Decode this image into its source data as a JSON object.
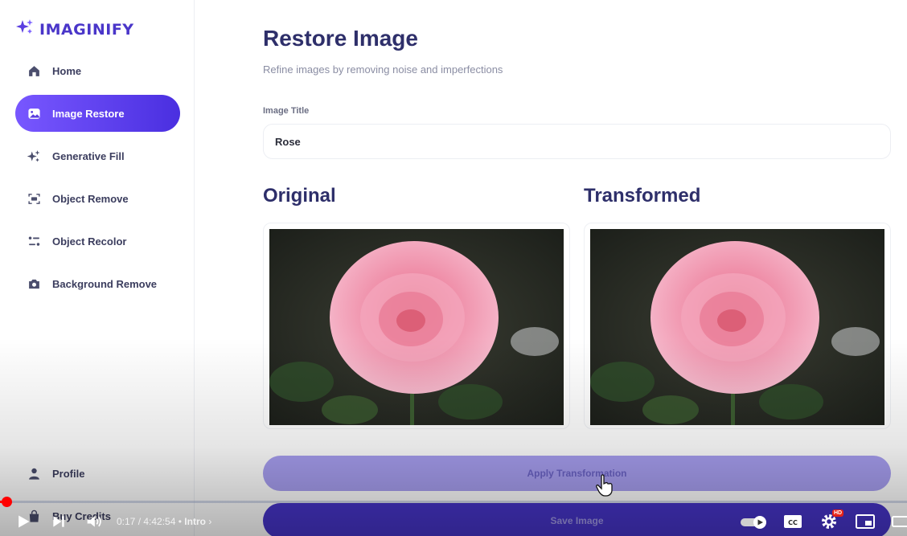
{
  "app": {
    "name": "IMAGINIFY"
  },
  "sidebar": {
    "items": [
      {
        "label": "Home",
        "icon": "home-icon",
        "active": false
      },
      {
        "label": "Image Restore",
        "icon": "image-icon",
        "active": true
      },
      {
        "label": "Generative Fill",
        "icon": "sparkles-icon",
        "active": false
      },
      {
        "label": "Object Remove",
        "icon": "scan-icon",
        "active": false
      },
      {
        "label": "Object Recolor",
        "icon": "filter-icon",
        "active": false
      },
      {
        "label": "Background Remove",
        "icon": "camera-icon",
        "active": false
      }
    ],
    "bottom": [
      {
        "label": "Profile",
        "icon": "user-icon"
      },
      {
        "label": "Buy Credits",
        "icon": "bag-icon"
      }
    ]
  },
  "main": {
    "title": "Restore Image",
    "subtitle": "Refine images by removing noise and imperfections",
    "field_label": "Image Title",
    "field_value": "Rose",
    "original_label": "Original",
    "transformed_label": "Transformed",
    "apply_label": "Apply Transformation",
    "save_label": "Save Image"
  },
  "player": {
    "time": "0:17 / 4:42:54",
    "separator": "•",
    "chapter": "Intro",
    "progress_fraction": 0.001,
    "hd_badge": "HD"
  },
  "colors": {
    "accent": "#4a36c9",
    "active_nav": "#6244f0",
    "title": "#2e2f6a",
    "progress": "#ff0000"
  }
}
